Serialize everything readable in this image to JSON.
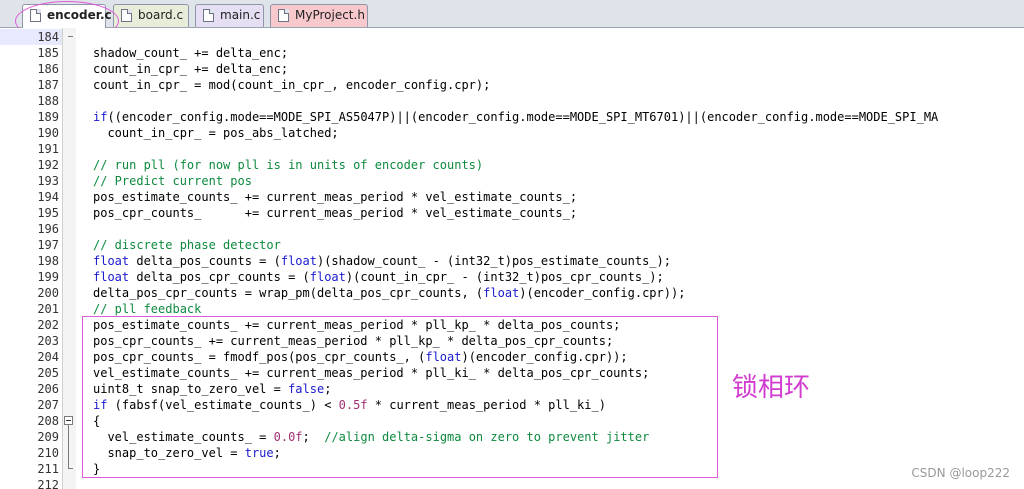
{
  "tabs": [
    {
      "label": "encoder.c",
      "active": true
    },
    {
      "label": "board.c",
      "active": false
    },
    {
      "label": "main.c",
      "active": false
    },
    {
      "label": "MyProject.h",
      "active": false
    }
  ],
  "editor": {
    "current_line": "184",
    "lines": [
      {
        "num": "184",
        "tokens": []
      },
      {
        "num": "185",
        "tokens": [
          [
            "",
            "shadow_count_ += delta_enc;"
          ]
        ]
      },
      {
        "num": "186",
        "tokens": [
          [
            "",
            "count_in_cpr_ += delta_enc;"
          ]
        ]
      },
      {
        "num": "187",
        "tokens": [
          [
            "",
            "count_in_cpr_ = mod(count_in_cpr_, encoder_config.cpr);"
          ]
        ]
      },
      {
        "num": "188",
        "tokens": []
      },
      {
        "num": "189",
        "tokens": [
          [
            "kw",
            "if"
          ],
          [
            "",
            "((encoder_config.mode==MODE_SPI_AS5047P)||(encoder_config.mode==MODE_SPI_MT6701)||(encoder_config.mode==MODE_SPI_MA"
          ]
        ]
      },
      {
        "num": "190",
        "tokens": [
          [
            "",
            "  count_in_cpr_ = pos_abs_latched;"
          ]
        ]
      },
      {
        "num": "191",
        "tokens": []
      },
      {
        "num": "192",
        "tokens": [
          [
            "cm",
            "// run pll (for now pll is in units of encoder counts)"
          ]
        ]
      },
      {
        "num": "193",
        "tokens": [
          [
            "cm",
            "// Predict current pos"
          ]
        ]
      },
      {
        "num": "194",
        "tokens": [
          [
            "",
            "pos_estimate_counts_ += current_meas_period * vel_estimate_counts_;"
          ]
        ]
      },
      {
        "num": "195",
        "tokens": [
          [
            "",
            "pos_cpr_counts_      += current_meas_period * vel_estimate_counts_;"
          ]
        ]
      },
      {
        "num": "196",
        "tokens": []
      },
      {
        "num": "197",
        "tokens": [
          [
            "cm",
            "// discrete phase detector"
          ]
        ]
      },
      {
        "num": "198",
        "tokens": [
          [
            "kw",
            "float"
          ],
          [
            "",
            " delta_pos_counts = ("
          ],
          [
            "kw",
            "float"
          ],
          [
            "",
            ")(shadow_count_ - (int32_t)pos_estimate_counts_);"
          ]
        ]
      },
      {
        "num": "199",
        "tokens": [
          [
            "kw",
            "float"
          ],
          [
            "",
            " delta_pos_cpr_counts = ("
          ],
          [
            "kw",
            "float"
          ],
          [
            "",
            ")(count_in_cpr_ - (int32_t)pos_cpr_counts_);"
          ]
        ]
      },
      {
        "num": "200",
        "tokens": [
          [
            "",
            "delta_pos_cpr_counts = wrap_pm(delta_pos_cpr_counts, ("
          ],
          [
            "kw",
            "float"
          ],
          [
            "",
            ")(encoder_config.cpr));"
          ]
        ]
      },
      {
        "num": "201",
        "tokens": [
          [
            "cm",
            "// pll feedback"
          ]
        ]
      },
      {
        "num": "202",
        "tokens": [
          [
            "",
            "pos_estimate_counts_ += current_meas_period * pll_kp_ * delta_pos_counts;"
          ]
        ]
      },
      {
        "num": "203",
        "tokens": [
          [
            "",
            "pos_cpr_counts_ += current_meas_period * pll_kp_ * delta_pos_cpr_counts;"
          ]
        ]
      },
      {
        "num": "204",
        "tokens": [
          [
            "",
            "pos_cpr_counts_ = fmodf_pos(pos_cpr_counts_, ("
          ],
          [
            "kw",
            "float"
          ],
          [
            "",
            ")(encoder_config.cpr));"
          ]
        ]
      },
      {
        "num": "205",
        "tokens": [
          [
            "",
            "vel_estimate_counts_ += current_meas_period * pll_ki_ * delta_pos_cpr_counts;"
          ]
        ]
      },
      {
        "num": "206",
        "tokens": [
          [
            "",
            "uint8_t snap_to_zero_vel = "
          ],
          [
            "kw",
            "false"
          ],
          [
            "",
            ";"
          ]
        ]
      },
      {
        "num": "207",
        "tokens": [
          [
            "kw",
            "if"
          ],
          [
            "",
            " (fabsf(vel_estimate_counts_) < "
          ],
          [
            "num",
            "0.5f"
          ],
          [
            "",
            " * current_meas_period * pll_ki_)"
          ]
        ]
      },
      {
        "num": "208",
        "tokens": [
          [
            "",
            "{"
          ]
        ]
      },
      {
        "num": "209",
        "tokens": [
          [
            "",
            "  vel_estimate_counts_ = "
          ],
          [
            "num",
            "0.0f"
          ],
          [
            "",
            ";  "
          ],
          [
            "cm",
            "//align delta-sigma on zero to prevent jitter"
          ]
        ]
      },
      {
        "num": "210",
        "tokens": [
          [
            "",
            "  snap_to_zero_vel = "
          ],
          [
            "kw",
            "true"
          ],
          [
            "",
            ";"
          ]
        ]
      },
      {
        "num": "211",
        "tokens": [
          [
            "",
            "}"
          ]
        ]
      },
      {
        "num": "212",
        "tokens": []
      }
    ]
  },
  "annotation": {
    "label": "锁相环"
  },
  "watermark": "CSDN @loop222",
  "colors": {
    "keyword": "#1a1ad0",
    "comment": "#0e8a3f",
    "number": "#a03070",
    "highlight": "#e05ad8"
  }
}
